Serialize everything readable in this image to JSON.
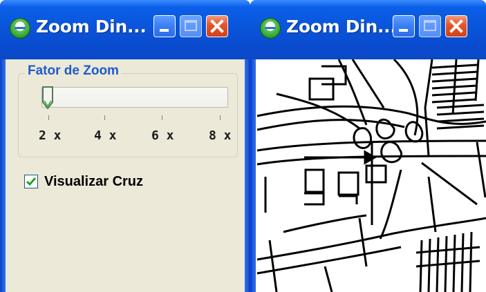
{
  "windows": [
    {
      "title": "Zoom Din...",
      "controls": {
        "minimize": "minimize-icon",
        "maximize": "maximize-icon",
        "close": "close-icon"
      },
      "zoom_group": {
        "label": "Fator de Zoom",
        "slider": {
          "tick_labels": [
            "2 x",
            "4 x",
            "6 x",
            "8 x"
          ],
          "selected": "2 x",
          "min": 2,
          "max": 8,
          "value": 2
        }
      },
      "show_cross": {
        "label": "Visualizar Cruz",
        "checked": true
      }
    },
    {
      "title": "Zoom Din...",
      "controls": {
        "minimize": "minimize-icon",
        "maximize": "maximize-icon",
        "close": "close-icon"
      },
      "view": {
        "content": "magnified-map-lines",
        "crosshair": "arrow-pointer"
      }
    }
  ],
  "colors": {
    "titlebar": "#0a55da",
    "frame": "#2a6ae8",
    "close_button": "#e4542a",
    "dialog_background": "#ece9d8",
    "group_label": "#1d5bc9",
    "check_mark": "#21a121"
  }
}
